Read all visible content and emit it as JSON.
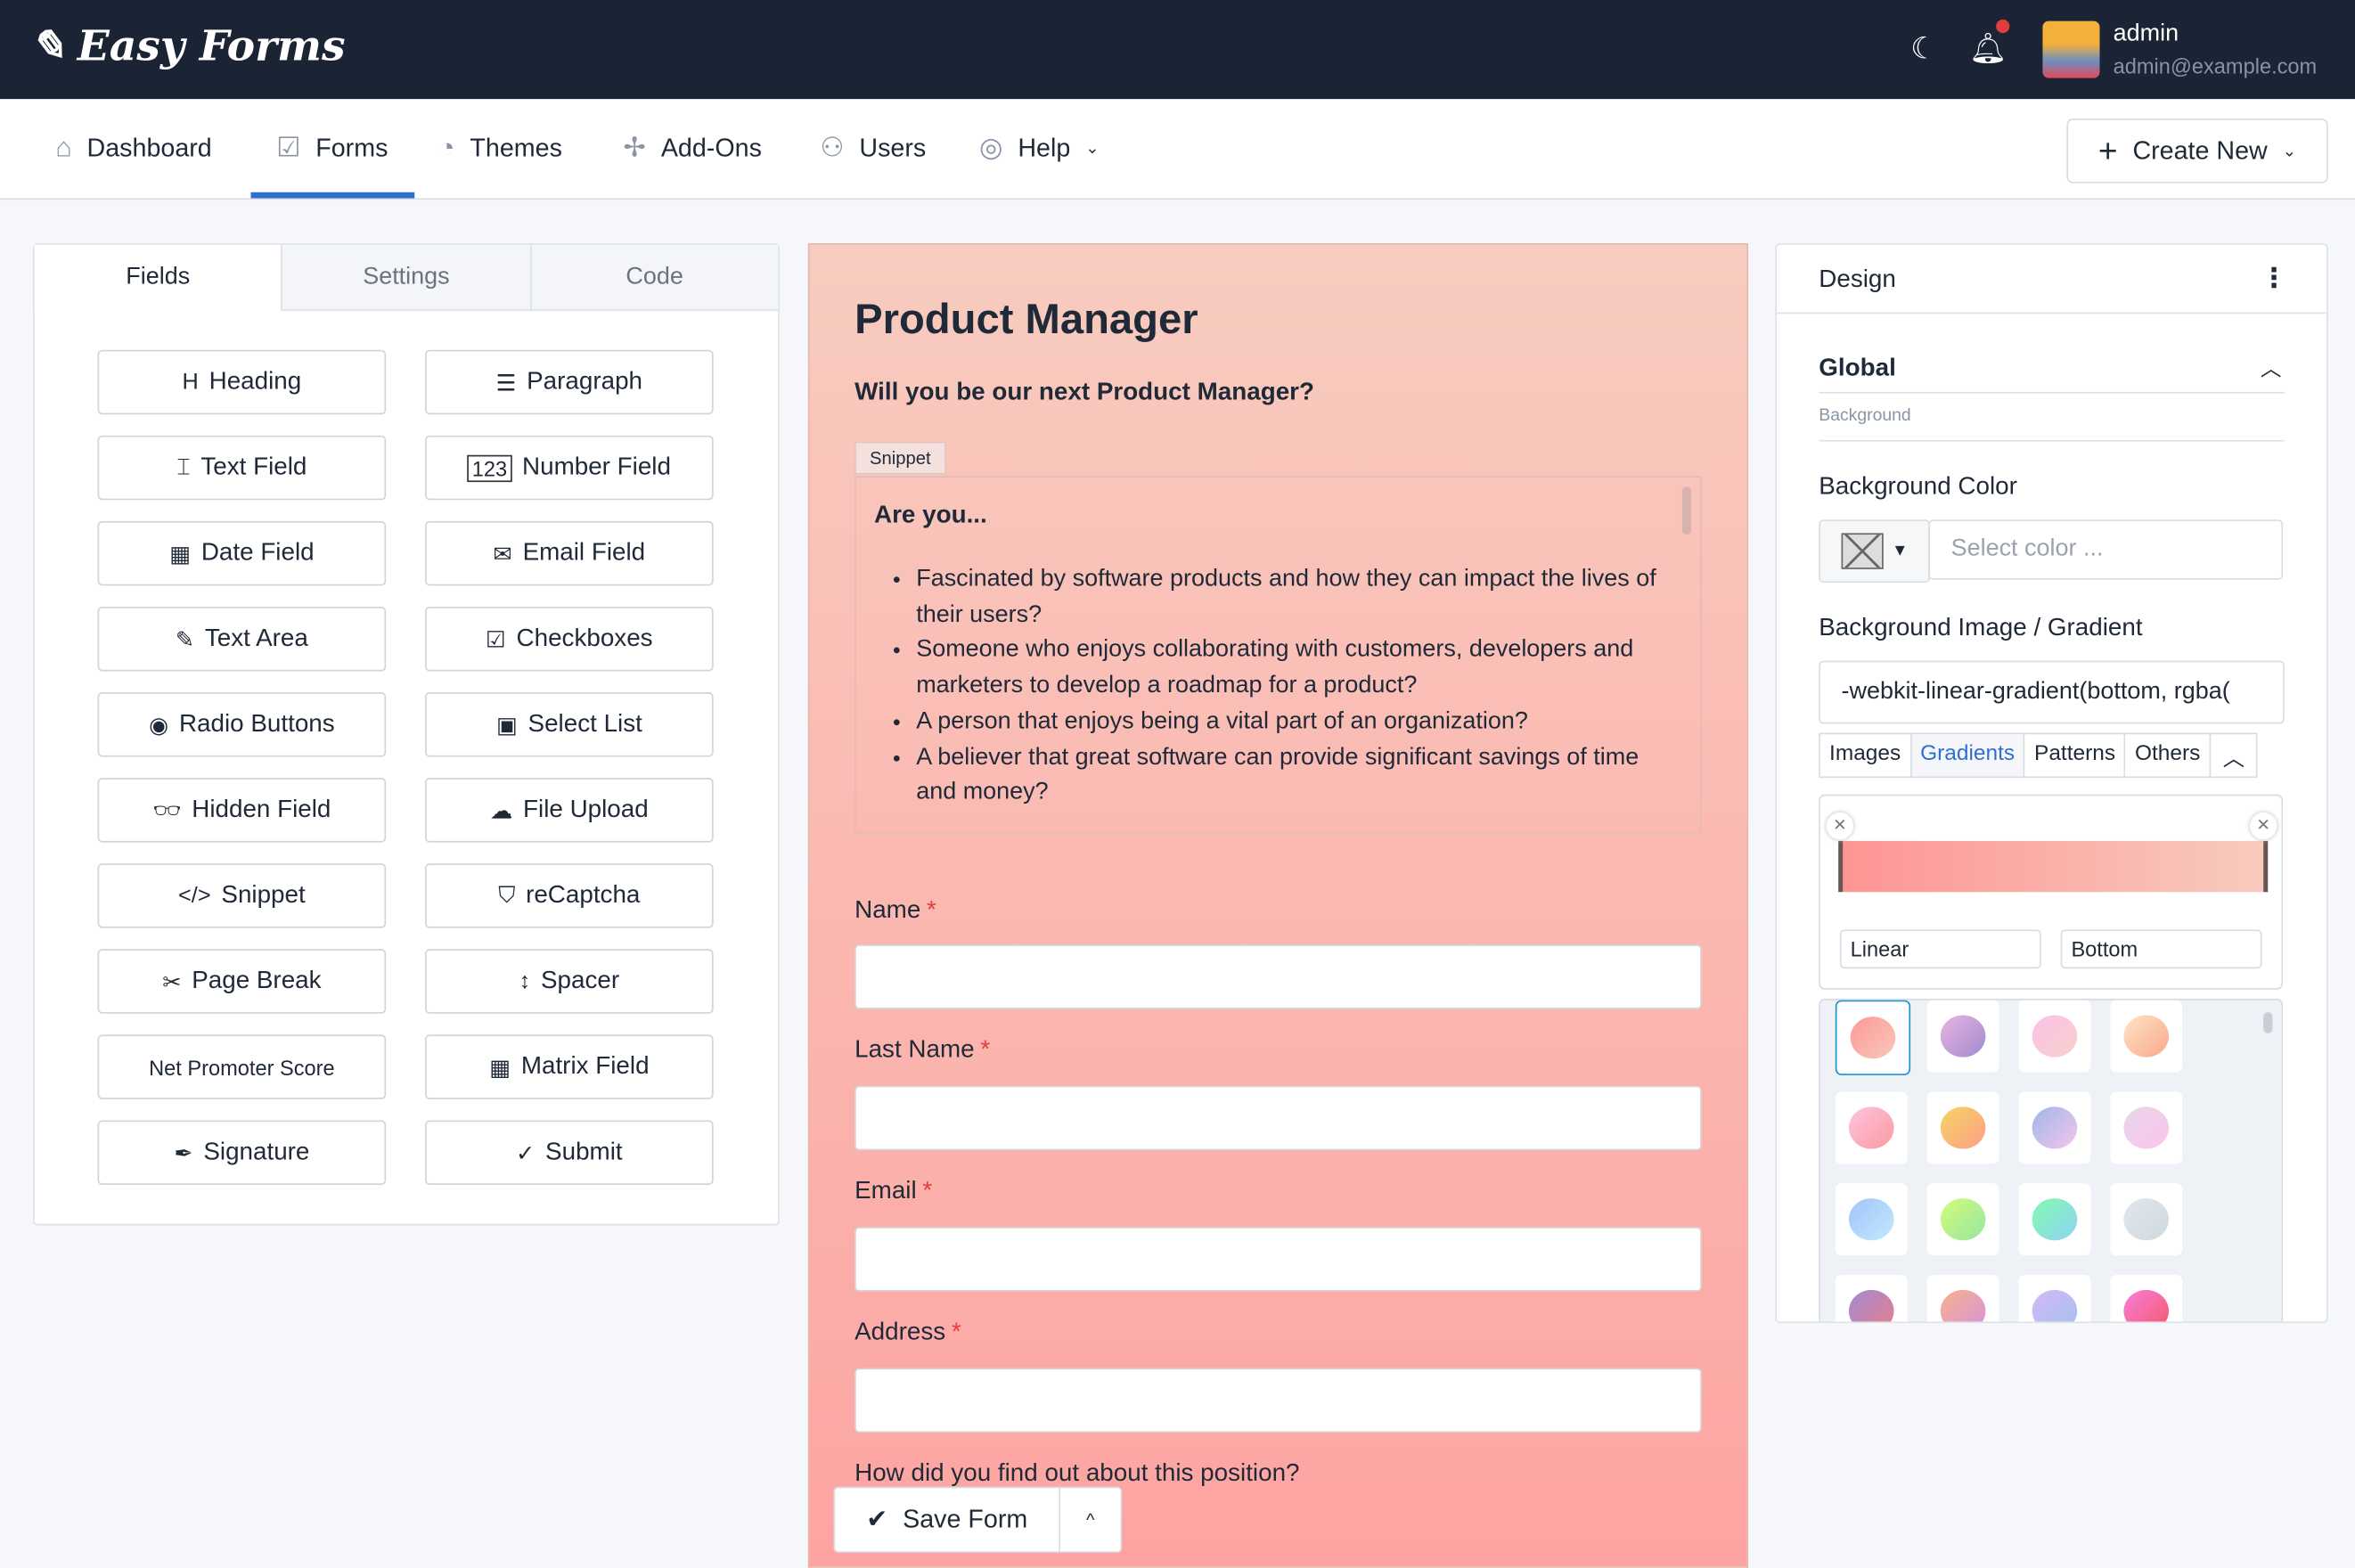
{
  "app": {
    "name": "Easy Forms",
    "user_name": "admin",
    "user_email": "admin@example.com"
  },
  "nav": {
    "items": [
      "Dashboard",
      "Forms",
      "Themes",
      "Add-Ons",
      "Users",
      "Help"
    ],
    "create": "Create New"
  },
  "left": {
    "tabs": [
      "Fields",
      "Settings",
      "Code"
    ],
    "fields": [
      "Heading",
      "Paragraph",
      "Text Field",
      "Number Field",
      "Date Field",
      "Email Field",
      "Text Area",
      "Checkboxes",
      "Radio Buttons",
      "Select List",
      "Hidden Field",
      "File Upload",
      "Snippet",
      "reCaptcha",
      "Page Break",
      "Spacer",
      "Net Promoter Score",
      "Matrix Field",
      "Signature",
      "Submit"
    ],
    "number_badge": "123"
  },
  "form": {
    "title": "Product Manager",
    "subtitle": "Will you be our next Product Manager?",
    "snippet_label": "Snippet",
    "snippet_heading": "Are you...",
    "bullets": [
      "Fascinated by software products and how they can impact the lives of their users?",
      "Someone who enjoys collaborating with customers, developers and marketers to develop a roadmap for a product?",
      "A person that enjoys being a vital part of an organization?",
      "A believer that great software can provide significant savings of time and money?"
    ],
    "fields": [
      "Name",
      "Last Name",
      "Email",
      "Address"
    ],
    "required_mark": "*",
    "question": "How did you find out about this position?",
    "save": "Save Form"
  },
  "design": {
    "title": "Design",
    "section": "Global",
    "subsection": "Background",
    "bg_color_label": "Background Color",
    "color_placeholder": "Select color ...",
    "bg_image_label": "Background Image / Gradient",
    "bg_image_value": "-webkit-linear-gradient(bottom, rgba(",
    "image_tabs": [
      "Images",
      "Gradients",
      "Patterns",
      "Others"
    ],
    "active_tab": "Gradients",
    "gradient_type": "Linear",
    "gradient_direction": "Bottom"
  },
  "colors": {
    "accent": "#2f6fce",
    "topbar": "#1b2434"
  }
}
